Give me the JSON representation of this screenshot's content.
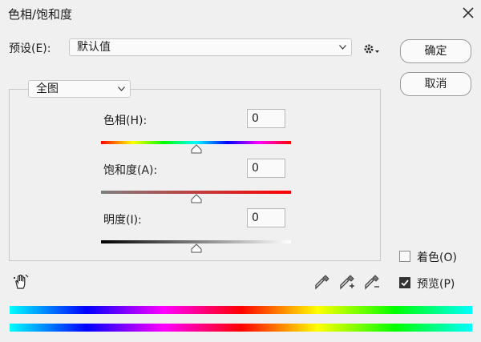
{
  "window": {
    "title": "色相/饱和度"
  },
  "preset": {
    "label": "预设(E):",
    "value": "默认值"
  },
  "buttons": {
    "ok": "确定",
    "cancel": "取消"
  },
  "channel": {
    "value": "全图"
  },
  "hue": {
    "label": "色相(H):",
    "value": "0",
    "slider_fraction": 0.5
  },
  "saturation": {
    "label": "饱和度(A):",
    "value": "0",
    "slider_fraction": 0.5
  },
  "lightness": {
    "label": "明度(I):",
    "value": "0",
    "slider_fraction": 0.5
  },
  "options": {
    "colorize": {
      "label": "着色(O)",
      "checked": false
    },
    "preview": {
      "label": "预览(P)",
      "checked": true
    }
  },
  "icons": {
    "close": "close-icon",
    "gear": "gear-icon",
    "hand": "targeted-adjustment-hand-icon",
    "eyedropper": "eyedropper-icon",
    "eyedropper_add": "eyedropper-plus-icon",
    "eyedropper_subtract": "eyedropper-minus-icon"
  }
}
